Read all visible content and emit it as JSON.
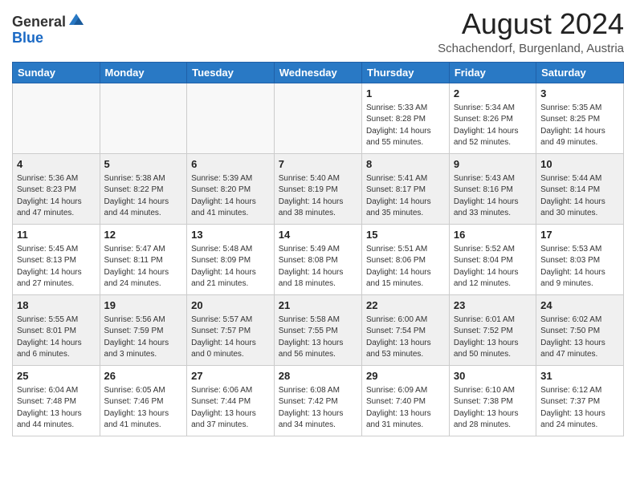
{
  "header": {
    "logo_general": "General",
    "logo_blue": "Blue",
    "month": "August 2024",
    "location": "Schachendorf, Burgenland, Austria"
  },
  "weekdays": [
    "Sunday",
    "Monday",
    "Tuesday",
    "Wednesday",
    "Thursday",
    "Friday",
    "Saturday"
  ],
  "weeks": [
    [
      {
        "day": "",
        "info": ""
      },
      {
        "day": "",
        "info": ""
      },
      {
        "day": "",
        "info": ""
      },
      {
        "day": "",
        "info": ""
      },
      {
        "day": "1",
        "info": "Sunrise: 5:33 AM\nSunset: 8:28 PM\nDaylight: 14 hours\nand 55 minutes."
      },
      {
        "day": "2",
        "info": "Sunrise: 5:34 AM\nSunset: 8:26 PM\nDaylight: 14 hours\nand 52 minutes."
      },
      {
        "day": "3",
        "info": "Sunrise: 5:35 AM\nSunset: 8:25 PM\nDaylight: 14 hours\nand 49 minutes."
      }
    ],
    [
      {
        "day": "4",
        "info": "Sunrise: 5:36 AM\nSunset: 8:23 PM\nDaylight: 14 hours\nand 47 minutes."
      },
      {
        "day": "5",
        "info": "Sunrise: 5:38 AM\nSunset: 8:22 PM\nDaylight: 14 hours\nand 44 minutes."
      },
      {
        "day": "6",
        "info": "Sunrise: 5:39 AM\nSunset: 8:20 PM\nDaylight: 14 hours\nand 41 minutes."
      },
      {
        "day": "7",
        "info": "Sunrise: 5:40 AM\nSunset: 8:19 PM\nDaylight: 14 hours\nand 38 minutes."
      },
      {
        "day": "8",
        "info": "Sunrise: 5:41 AM\nSunset: 8:17 PM\nDaylight: 14 hours\nand 35 minutes."
      },
      {
        "day": "9",
        "info": "Sunrise: 5:43 AM\nSunset: 8:16 PM\nDaylight: 14 hours\nand 33 minutes."
      },
      {
        "day": "10",
        "info": "Sunrise: 5:44 AM\nSunset: 8:14 PM\nDaylight: 14 hours\nand 30 minutes."
      }
    ],
    [
      {
        "day": "11",
        "info": "Sunrise: 5:45 AM\nSunset: 8:13 PM\nDaylight: 14 hours\nand 27 minutes."
      },
      {
        "day": "12",
        "info": "Sunrise: 5:47 AM\nSunset: 8:11 PM\nDaylight: 14 hours\nand 24 minutes."
      },
      {
        "day": "13",
        "info": "Sunrise: 5:48 AM\nSunset: 8:09 PM\nDaylight: 14 hours\nand 21 minutes."
      },
      {
        "day": "14",
        "info": "Sunrise: 5:49 AM\nSunset: 8:08 PM\nDaylight: 14 hours\nand 18 minutes."
      },
      {
        "day": "15",
        "info": "Sunrise: 5:51 AM\nSunset: 8:06 PM\nDaylight: 14 hours\nand 15 minutes."
      },
      {
        "day": "16",
        "info": "Sunrise: 5:52 AM\nSunset: 8:04 PM\nDaylight: 14 hours\nand 12 minutes."
      },
      {
        "day": "17",
        "info": "Sunrise: 5:53 AM\nSunset: 8:03 PM\nDaylight: 14 hours\nand 9 minutes."
      }
    ],
    [
      {
        "day": "18",
        "info": "Sunrise: 5:55 AM\nSunset: 8:01 PM\nDaylight: 14 hours\nand 6 minutes."
      },
      {
        "day": "19",
        "info": "Sunrise: 5:56 AM\nSunset: 7:59 PM\nDaylight: 14 hours\nand 3 minutes."
      },
      {
        "day": "20",
        "info": "Sunrise: 5:57 AM\nSunset: 7:57 PM\nDaylight: 14 hours\nand 0 minutes."
      },
      {
        "day": "21",
        "info": "Sunrise: 5:58 AM\nSunset: 7:55 PM\nDaylight: 13 hours\nand 56 minutes."
      },
      {
        "day": "22",
        "info": "Sunrise: 6:00 AM\nSunset: 7:54 PM\nDaylight: 13 hours\nand 53 minutes."
      },
      {
        "day": "23",
        "info": "Sunrise: 6:01 AM\nSunset: 7:52 PM\nDaylight: 13 hours\nand 50 minutes."
      },
      {
        "day": "24",
        "info": "Sunrise: 6:02 AM\nSunset: 7:50 PM\nDaylight: 13 hours\nand 47 minutes."
      }
    ],
    [
      {
        "day": "25",
        "info": "Sunrise: 6:04 AM\nSunset: 7:48 PM\nDaylight: 13 hours\nand 44 minutes."
      },
      {
        "day": "26",
        "info": "Sunrise: 6:05 AM\nSunset: 7:46 PM\nDaylight: 13 hours\nand 41 minutes."
      },
      {
        "day": "27",
        "info": "Sunrise: 6:06 AM\nSunset: 7:44 PM\nDaylight: 13 hours\nand 37 minutes."
      },
      {
        "day": "28",
        "info": "Sunrise: 6:08 AM\nSunset: 7:42 PM\nDaylight: 13 hours\nand 34 minutes."
      },
      {
        "day": "29",
        "info": "Sunrise: 6:09 AM\nSunset: 7:40 PM\nDaylight: 13 hours\nand 31 minutes."
      },
      {
        "day": "30",
        "info": "Sunrise: 6:10 AM\nSunset: 7:38 PM\nDaylight: 13 hours\nand 28 minutes."
      },
      {
        "day": "31",
        "info": "Sunrise: 6:12 AM\nSunset: 7:37 PM\nDaylight: 13 hours\nand 24 minutes."
      }
    ]
  ]
}
